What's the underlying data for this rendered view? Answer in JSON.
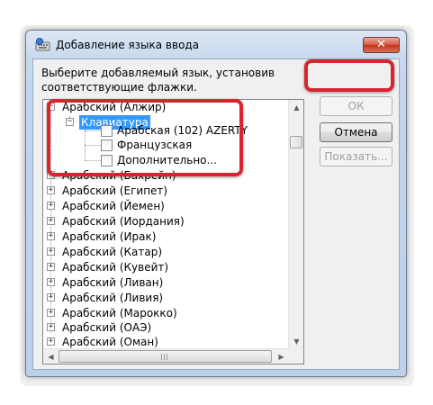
{
  "window": {
    "title": "Добавление языка ввода",
    "close_label": "✕"
  },
  "prompt": {
    "line1": "Выберите добавляемый язык, установив",
    "line2": "соответствующие флажки."
  },
  "buttons": {
    "ok_label": "ОК",
    "cancel_label": "Отмена",
    "show_label": "Показать..."
  },
  "tree": {
    "root": "Арабский (Алжир)",
    "keyboard": "Клавиатура",
    "options": [
      "Арабская (102) AZERTY",
      "Французская",
      "Дополнительно..."
    ],
    "languages": [
      "Арабский (Бахрейн)",
      "Арабский (Египет)",
      "Арабский (Йемен)",
      "Арабский (Иордания)",
      "Арабский (Ирак)",
      "Арабский (Катар)",
      "Арабский (Кувейт)",
      "Арабский (Ливан)",
      "Арабский (Ливия)",
      "Арабский (Марокко)",
      "Арабский (ОАЭ)",
      "Арабский (Оман)"
    ]
  },
  "colors": {
    "highlight": "#d7252f",
    "selection": "#3399ff"
  }
}
